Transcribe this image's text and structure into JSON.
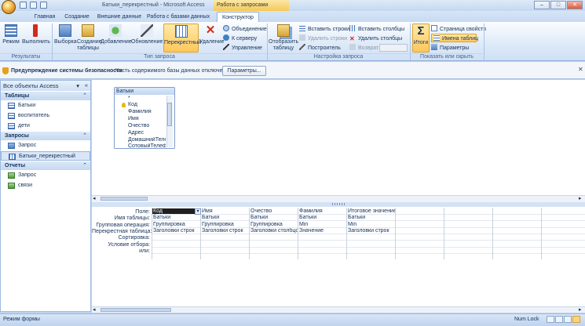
{
  "window": {
    "title": "Батьки_перекрестный - Microsoft Access",
    "context_title": "Работа с запросами"
  },
  "tabs": [
    "Главная",
    "Создание",
    "Внешние данные",
    "Работа с базами данных",
    "Конструктор"
  ],
  "ribbon": {
    "groups": {
      "results": "Результаты",
      "query_type": "Тип запроса",
      "query_setup": "Настройка запроса",
      "show_hide": "Показать или скрыть"
    },
    "results": {
      "mode": "Режим",
      "run": "Выполнить"
    },
    "query_type": {
      "select": "Выборка",
      "make_table_1": "Создание",
      "make_table_2": "таблицы",
      "append": "Добавление",
      "update": "Обновление",
      "crosstab": "Перекрестный",
      "delete": "Удаление",
      "union": "Объединение",
      "server": "К серверу",
      "manage": "Управление"
    },
    "query_setup": {
      "show_table_1": "Отобразить",
      "show_table_2": "таблицу",
      "insert_rows": "Вставить строки",
      "delete_rows": "Удалить строки",
      "builder": "Построитель",
      "insert_cols": "Вставить столбцы",
      "delete_cols": "Удалить столбцы",
      "return": "Возврат:"
    },
    "show_hide": {
      "totals": "Итоги",
      "property_sheet": "Страница свойств",
      "table_names": "Имена таблиц",
      "parameters": "Параметры"
    }
  },
  "security": {
    "bold": "Предупреждение системы безопасности",
    "message": "Часть содержимого базы данных отключено",
    "button": "Параметры..."
  },
  "nav": {
    "header": "Все объекты Access",
    "sections": [
      {
        "title": "Таблицы",
        "items": [
          "Батьки",
          "воспитатель",
          "дети"
        ]
      },
      {
        "title": "Запросы",
        "items": [
          "Запрос",
          "Батьки_перекрестный"
        ]
      },
      {
        "title": "Отчеты",
        "items": [
          "Запрос",
          "связи"
        ]
      }
    ]
  },
  "field_list": {
    "title": "Батьки",
    "fields": [
      "*",
      "Код",
      "Фамилия",
      "Имя",
      "Очество",
      "Адрес",
      "ДомашнийТелеф",
      "СотовыйТелефон"
    ]
  },
  "grid": {
    "row_labels": [
      "Поле:",
      "Имя таблицы:",
      "Групповая операция:",
      "Перекрестная таблица:",
      "Сортировка:",
      "Условие отбора:",
      "или:"
    ],
    "columns": [
      [
        "Код",
        "Батьки",
        "Группировка",
        "Заголовки строк",
        "",
        "",
        ""
      ],
      [
        "Имя",
        "Батьки",
        "Группировка",
        "Заголовки строк",
        "",
        "",
        ""
      ],
      [
        "Очество",
        "Батьки",
        "Группировка",
        "Заголовки столбцов",
        "",
        "",
        ""
      ],
      [
        "Фамилия",
        "Батьки",
        "Min",
        "Значение",
        "",
        "",
        ""
      ],
      [
        "Итоговое значение С",
        "Батьки",
        "Min",
        "Заголовки строк",
        "",
        "",
        ""
      ],
      [
        "",
        "",
        "",
        "",
        "",
        "",
        ""
      ],
      [
        "",
        "",
        "",
        "",
        "",
        "",
        ""
      ],
      [
        "",
        "",
        "",
        "",
        "",
        "",
        ""
      ],
      [
        "",
        "",
        "",
        "",
        "",
        "",
        ""
      ]
    ]
  },
  "status": {
    "left": "Режим формы",
    "right": "Num Lock"
  },
  "colors": {
    "accent": "#ffc75a",
    "ribbon": "#dde9f8",
    "frame": "#bcd3ee"
  }
}
